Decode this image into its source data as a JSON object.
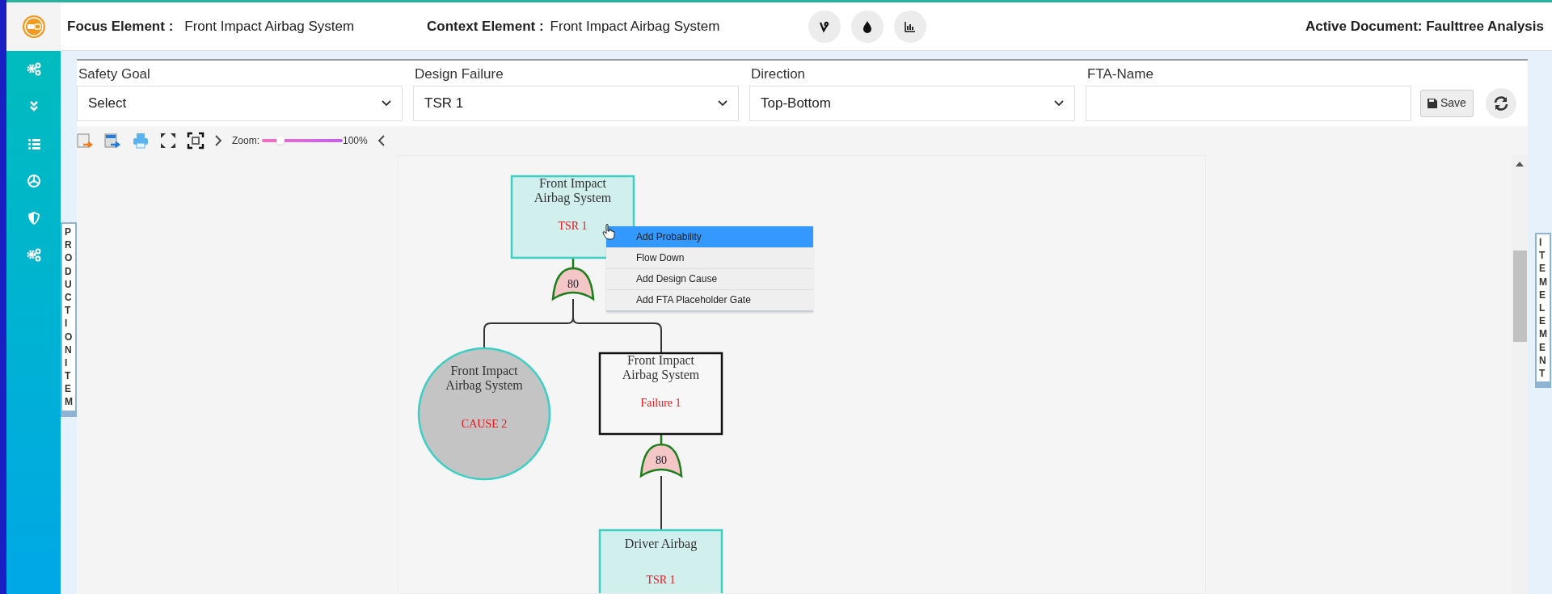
{
  "sidebar": {
    "items": [
      {
        "kind": "cogs"
      },
      {
        "kind": "chevrons"
      },
      {
        "kind": "list"
      },
      {
        "kind": "wheel"
      },
      {
        "kind": "shield"
      },
      {
        "kind": "cogs"
      }
    ]
  },
  "header": {
    "focus_label": "Focus Element :",
    "focus_value": "Front Impact Airbag System",
    "context_label": "Context Element :",
    "context_value": "Front Impact Airbag System",
    "tools": [
      {
        "kind": "vine"
      },
      {
        "kind": "drop"
      },
      {
        "kind": "chart"
      }
    ],
    "active_document": "Active Document: Faulttree Analysis"
  },
  "filters": [
    {
      "kind": "select",
      "label": "Safety Goal",
      "value": "Select"
    },
    {
      "kind": "select",
      "label": "Design Failure",
      "value": "TSR 1"
    },
    {
      "kind": "select",
      "label": "Direction",
      "value": "Top-Bottom"
    },
    {
      "kind": "text",
      "label": "FTA-Name"
    }
  ],
  "save_button": "Save",
  "toolbar": {
    "zoom_label": "Zoom:",
    "level": 0.2,
    "zoom_reading": "100%"
  },
  "side_tabs": {
    "left": "PRODUCTION ITEM",
    "right": "ITEM ELEMENT"
  },
  "diagram": {
    "nodes": [
      {
        "kind": "requirement",
        "title": [
          "Front Impact",
          "Airbag System"
        ],
        "label": "TSR 1"
      },
      {
        "kind": "cause",
        "title": [
          "Front Impact",
          "Airbag System"
        ],
        "label": "CAUSE 2"
      },
      {
        "kind": "failure",
        "title": [
          "Front Impact",
          "Airbag System"
        ],
        "label": "Failure 1"
      },
      {
        "kind": "requirement",
        "title": [
          "Driver Airbag"
        ],
        "label": "TSR 1"
      }
    ],
    "gates": [
      {
        "value": "80"
      },
      {
        "value": "80"
      }
    ]
  },
  "context_menu": {
    "items": [
      {
        "label": "Add Probability",
        "selected": true
      },
      {
        "label": "Flow Down",
        "selected": false
      },
      {
        "label": "Add Design Cause",
        "selected": false
      },
      {
        "label": "Add FTA Placeholder Gate",
        "selected": false
      }
    ]
  }
}
